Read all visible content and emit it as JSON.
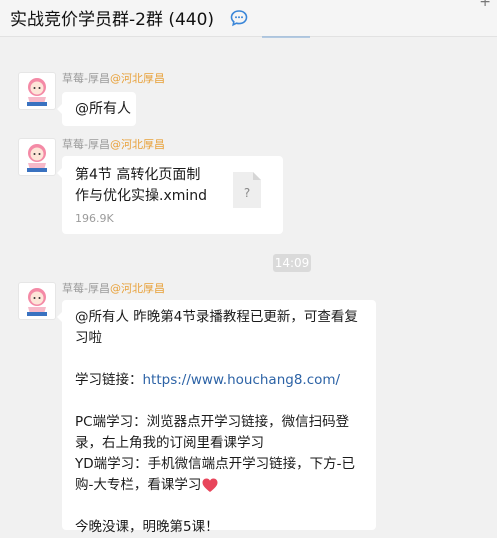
{
  "header": {
    "title": "实战竞价学员群-2群 (440)",
    "add_symbol": "+"
  },
  "messages": [
    {
      "sender_name": "草莓-厚昌",
      "sender_location": "@河北厚昌",
      "text": "@所有人"
    },
    {
      "sender_name": "草莓-厚昌",
      "sender_location": "@河北厚昌",
      "file": {
        "name_line1": "第4节 高转化页面制",
        "name_line2": "作与优化实操.xmind",
        "size": "196.9K",
        "icon_glyph": "?"
      }
    },
    {
      "sender_name": "草莓-厚昌",
      "sender_location": "@河北厚昌",
      "lines": [
        "@所有人 昨晚第4节录播教程已更新，可查看复",
        "习啦",
        "",
        "学习链接：",
        "https://www.houchang8.com/",
        "",
        "PC端学习：浏览器点开学习链接，微信扫码登",
        "录，右上角我的订阅里看课学习",
        "YD端学习：手机微信端点开学习链接，下方-已",
        "购-大专栏，看课学习",
        "",
        "今晚没课，明晚第5课！"
      ]
    }
  ],
  "timestamp": "14:09",
  "colors": {
    "link": "#2d63a6",
    "location": "#e8a13a",
    "heart": "#e8455b"
  },
  "icons": [
    "chat-bubble-icon",
    "avatar-icon",
    "xmind-file-icon",
    "heart-emoji-icon"
  ]
}
